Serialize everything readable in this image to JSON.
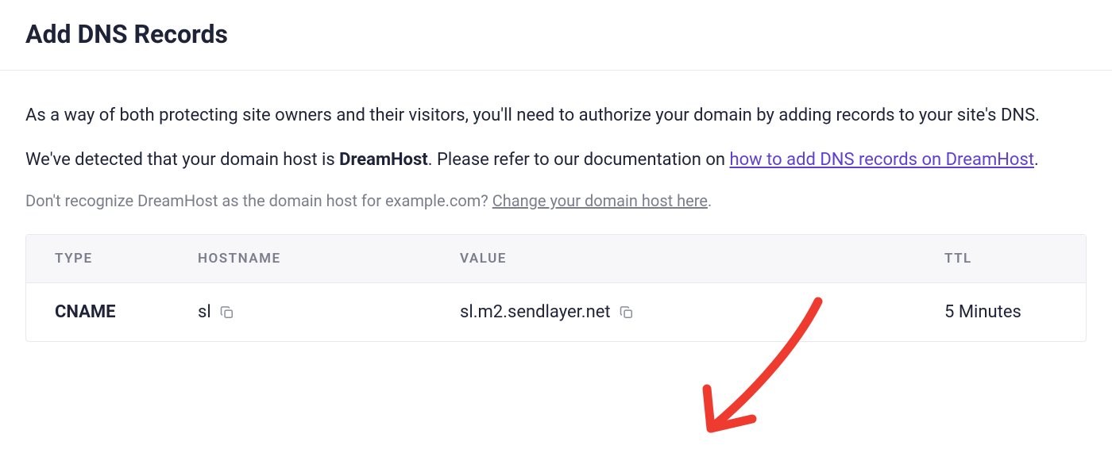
{
  "title": "Add DNS Records",
  "body": {
    "intro": "As a way of both protecting site owners and their visitors, you'll need to authorize your domain by adding records to your site's DNS.",
    "detected_pre": "We've detected that your domain host is ",
    "host_name": "DreamHost",
    "detected_post": ". Please refer to our documentation on ",
    "doc_link": "how to add DNS records on DreamHost",
    "period": ".",
    "unrecognized_pre": "Don't recognize DreamHost as the domain host for example.com? ",
    "change_link": "Change your domain host here",
    "unrecognized_post": "."
  },
  "table": {
    "headers": {
      "type": "TYPE",
      "hostname": "HOSTNAME",
      "value": "VALUE",
      "ttl": "TTL"
    },
    "row": {
      "type": "CNAME",
      "hostname": "sl",
      "value": "sl.m2.sendlayer.net",
      "ttl": "5 Minutes"
    }
  }
}
